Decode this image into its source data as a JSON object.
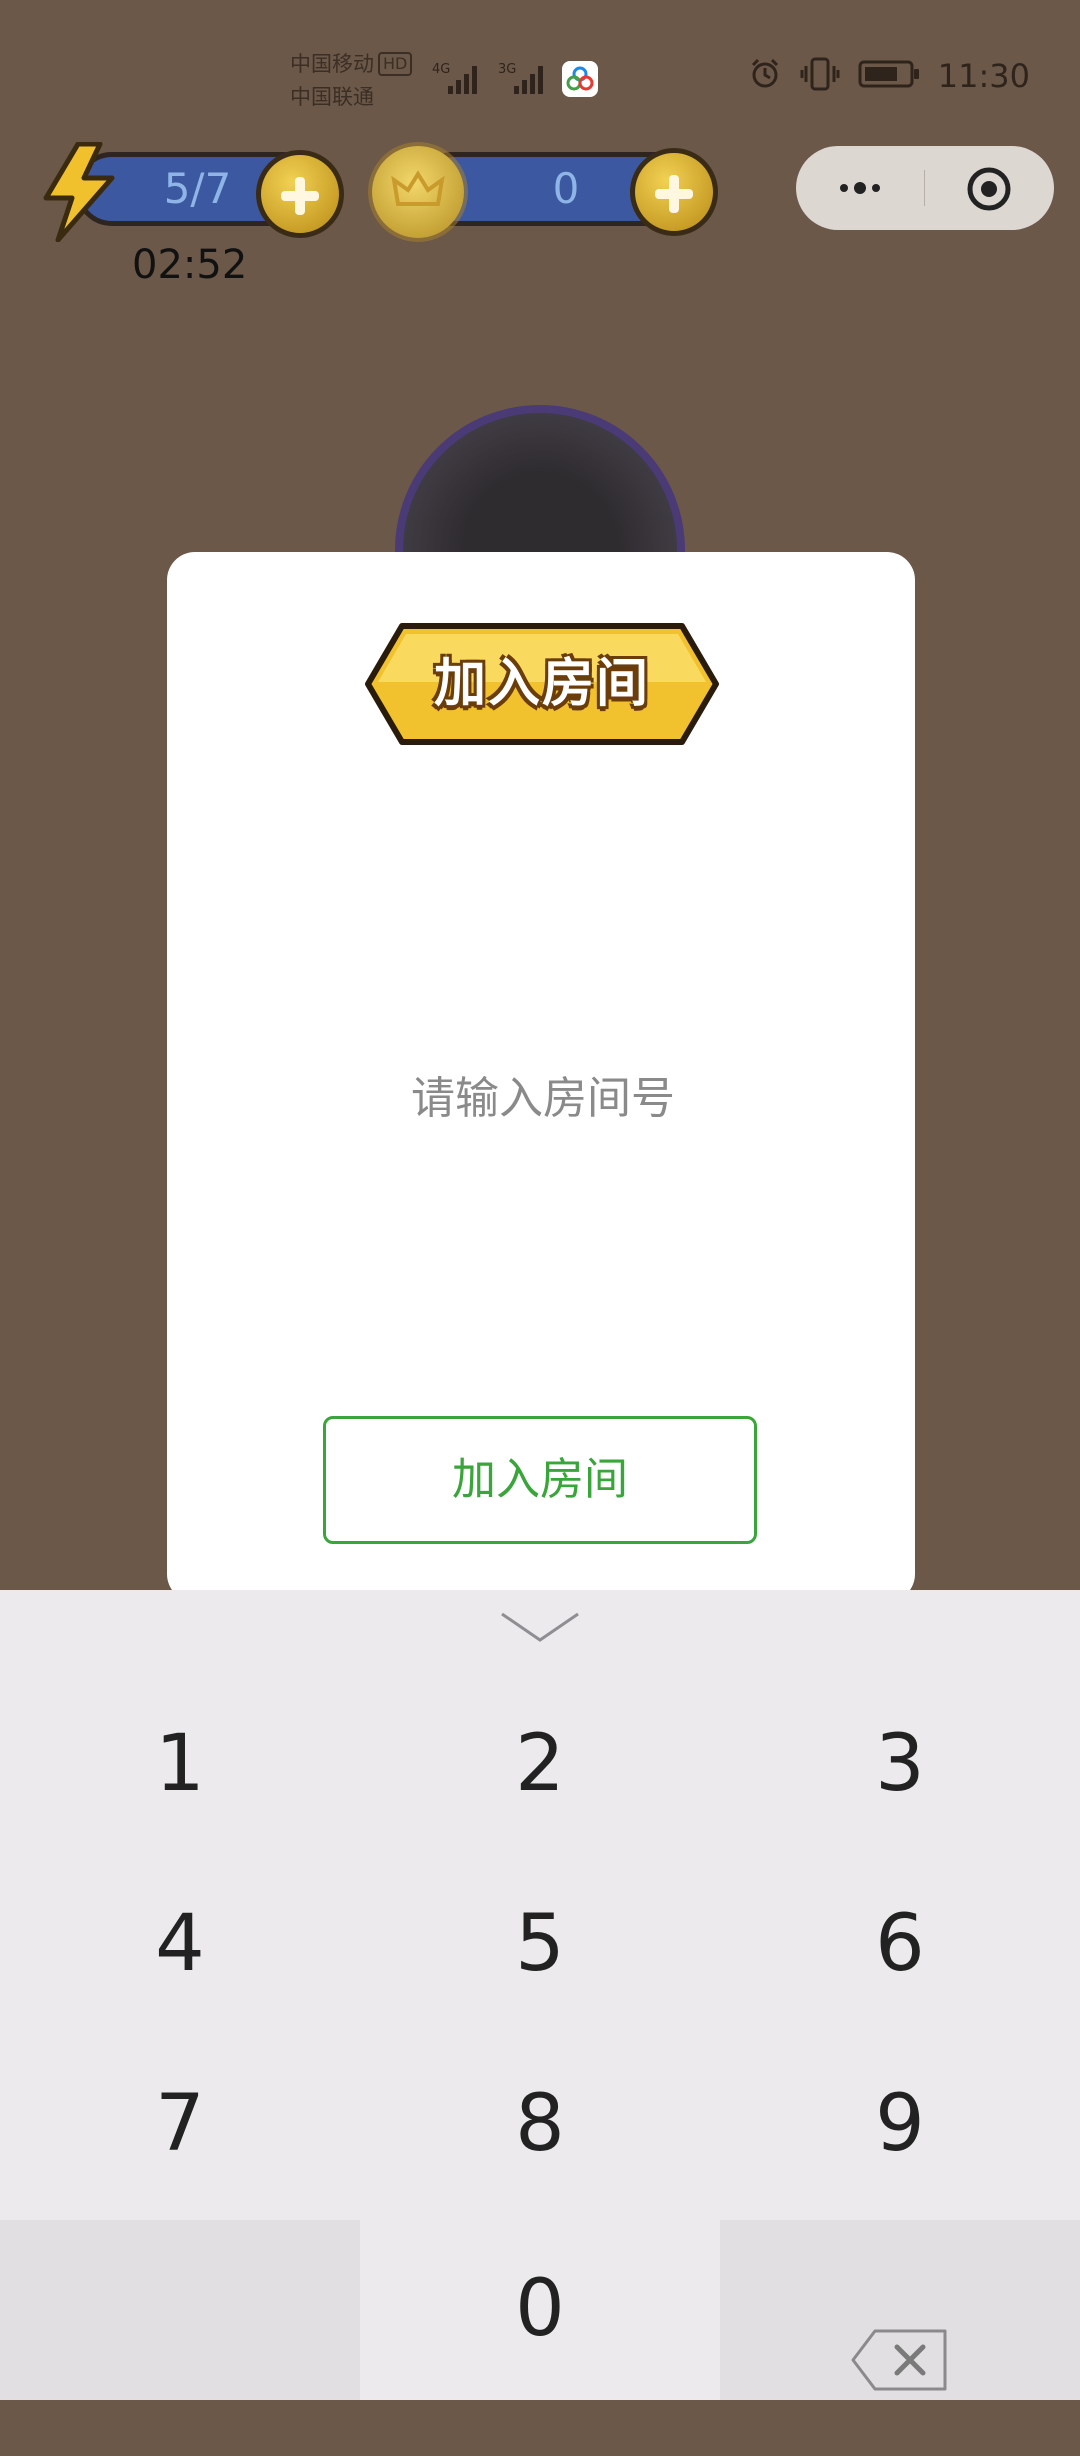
{
  "status_bar": {
    "carrier_1": "中国移动",
    "carrier_1_badge": "HD",
    "carrier_2": "中国联通",
    "network_1": "4G",
    "network_2": "3G",
    "time": "11:30",
    "icons": [
      "alarm-icon",
      "vibrate-icon",
      "battery-icon"
    ]
  },
  "game_hud": {
    "energy_value": "5/7",
    "energy_timer": "02:52",
    "coin_value": "0"
  },
  "dialog": {
    "title": "加入房间",
    "input_placeholder": "请输入房间号",
    "input_value": "",
    "join_button_label": "加入房间"
  },
  "keyboard": {
    "keys": [
      "1",
      "2",
      "3",
      "4",
      "5",
      "6",
      "7",
      "8",
      "9",
      "",
      "0",
      ""
    ]
  },
  "colors": {
    "background": "#6b5849",
    "accent_green": "#3aa53a",
    "badge_yellow": "#f9d84a",
    "pill_blue": "#3c58a1"
  }
}
